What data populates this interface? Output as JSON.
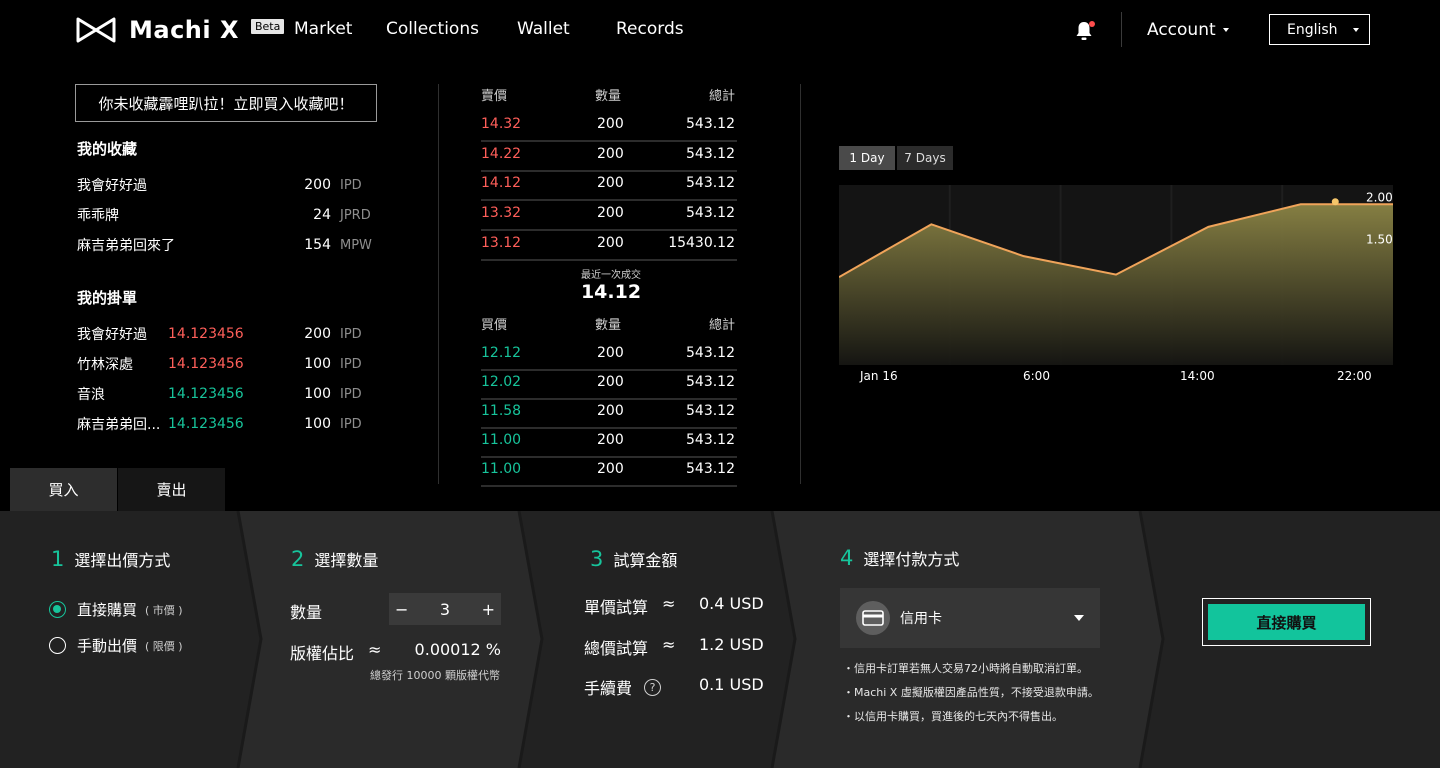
{
  "header": {
    "brand": "Machi X",
    "beta_badge": "Beta",
    "nav": [
      "Market",
      "Collections",
      "Wallet",
      "Records"
    ],
    "account_label": "Account",
    "language": "English"
  },
  "promo_text": "你未收藏霹哩趴拉！立即買入收藏吧！",
  "collection": {
    "title": "我的收藏",
    "items": [
      {
        "name": "我會好好過",
        "qty": "200",
        "unit": "IPD"
      },
      {
        "name": "乖乖牌",
        "qty": "24",
        "unit": "JPRD"
      },
      {
        "name": "麻吉弟弟回來了",
        "qty": "154",
        "unit": "MPW"
      }
    ]
  },
  "orders": {
    "title": "我的掛單",
    "items": [
      {
        "name": "我會好好過",
        "price": "14.123456",
        "qty": "200",
        "unit": "IPD",
        "color": "#ff5f5a"
      },
      {
        "name": "竹林深處",
        "price": "14.123456",
        "qty": "100",
        "unit": "IPD",
        "color": "#ff5f5a"
      },
      {
        "name": "音浪",
        "price": "14.123456",
        "qty": "100",
        "unit": "IPD",
        "color": "#17c49b"
      },
      {
        "name": "麻吉弟弟回...",
        "price": "14.123456",
        "qty": "100",
        "unit": "IPD",
        "color": "#17c49b"
      }
    ]
  },
  "order_book": {
    "sell_header": {
      "price": "賣價",
      "qty": "數量",
      "total": "總計"
    },
    "sell": [
      {
        "price": "14.32",
        "qty": "200",
        "total": "543.12"
      },
      {
        "price": "14.22",
        "qty": "200",
        "total": "543.12"
      },
      {
        "price": "14.12",
        "qty": "200",
        "total": "543.12"
      },
      {
        "price": "13.32",
        "qty": "200",
        "total": "543.12"
      },
      {
        "price": "13.12",
        "qty": "200",
        "total": "15430.12"
      }
    ],
    "last_trade_label": "最近一次成交",
    "last_trade_price": "14.12",
    "buy_header": {
      "price": "買價",
      "qty": "數量",
      "total": "總計"
    },
    "buy": [
      {
        "price": "12.12",
        "qty": "200",
        "total": "543.12"
      },
      {
        "price": "12.02",
        "qty": "200",
        "total": "543.12"
      },
      {
        "price": "11.58",
        "qty": "200",
        "total": "543.12"
      },
      {
        "price": "11.00",
        "qty": "200",
        "total": "543.12"
      },
      {
        "price": "11.00",
        "qty": "200",
        "total": "543.12"
      }
    ],
    "sell_color": "#ff5f5a",
    "buy_color": "#17c49b"
  },
  "chart_controls": {
    "range_1d": "1 Day",
    "range_7d": "7 Days",
    "active": "1 Day"
  },
  "chart_data": {
    "type": "area",
    "title": "",
    "xlabel": "",
    "ylabel": "",
    "x_ticks": [
      "Jan 16",
      "6:00",
      "14:00",
      "22:00"
    ],
    "y_ticks": [
      "2.00",
      "1.50"
    ],
    "y_tick_values": [
      2.0,
      1.5
    ],
    "ylim": [
      0.0,
      2.15
    ],
    "x": [
      0,
      4,
      8,
      12,
      16,
      20,
      24
    ],
    "values": [
      1.05,
      1.68,
      1.3,
      1.08,
      1.65,
      1.92,
      1.92
    ],
    "x_range": [
      0,
      24
    ],
    "highlight_point": {
      "x": 21.5,
      "y": 1.95
    },
    "line_color": "#f0a45a",
    "fill_top": "#8b8445",
    "grid": true,
    "legend": "none"
  },
  "trade_tabs": {
    "buy": "買入",
    "sell": "賣出",
    "active": "buy"
  },
  "step1": {
    "num": "1",
    "title": "選擇出價方式",
    "options": [
      {
        "label": "直接購買",
        "note": "( 市價 )",
        "selected": true
      },
      {
        "label": "手動出價",
        "note": "( 限價 )",
        "selected": false
      }
    ]
  },
  "step2": {
    "num": "2",
    "title": "選擇數量",
    "qty_label": "數量",
    "minus": "−",
    "qty_value": "3",
    "plus": "+",
    "share_label": "版權佔比",
    "approx": "≈",
    "share_value": "0.00012 %",
    "issued_note": "總發行 10000 顆版權代幣"
  },
  "step3": {
    "num": "3",
    "title": "試算金額",
    "unit_label": "單價試算",
    "unit_value": "0.4 USD",
    "total_label": "總價試算",
    "total_value": "1.2 USD",
    "fee_label": "手續費",
    "fee_value": "0.1 USD",
    "approx": "≈",
    "help": "?"
  },
  "step4": {
    "num": "4",
    "title": "選擇付款方式",
    "method": "信用卡",
    "notes": [
      "・信用卡訂單若無人交易72小時將自動取消訂單。",
      "・Machi X 虛擬版權因產品性質，不接受退款申請。",
      "・以信用卡購買，買進後的七天內不得售出。"
    ]
  },
  "submit_label": "直接購買"
}
